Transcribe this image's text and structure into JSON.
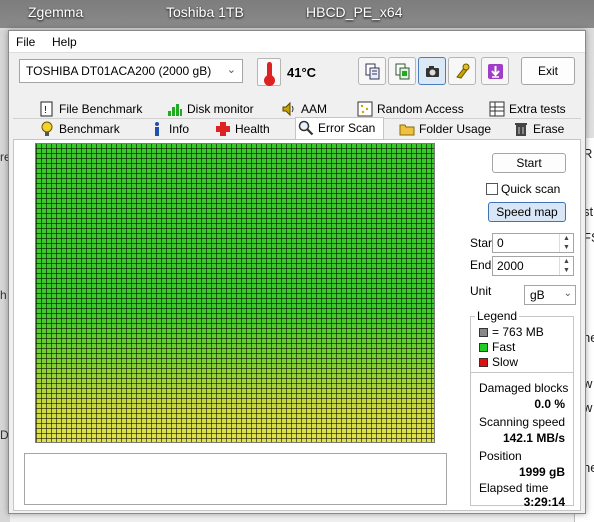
{
  "desktop": {
    "labels": [
      "Zgemma",
      "Toshiba 1TB",
      "HBCD_PE_x64"
    ],
    "right_panel_text": [
      "R",
      "st",
      "FS",
      "ne",
      "w",
      "w",
      "ne"
    ],
    "left_strip_text": [
      "re",
      "h",
      "D"
    ]
  },
  "window": {
    "menu": {
      "file": "File",
      "help": "Help"
    },
    "drive": {
      "selected": "TOSHIBA DT01ACA200 (2000 gB)"
    },
    "temperature": "41°C",
    "toolbar_icons": [
      "copy-text-icon",
      "copy-info-icon",
      "screenshot-camera-icon",
      "options-icon",
      "download-icon"
    ],
    "exit_label": "Exit"
  },
  "tabs": {
    "row1": [
      {
        "label": "File Benchmark",
        "icon": "file-benchmark-icon"
      },
      {
        "label": "Disk monitor",
        "icon": "disk-monitor-icon"
      },
      {
        "label": "AAM",
        "icon": "speaker-icon"
      },
      {
        "label": "Random Access",
        "icon": "random-access-icon"
      },
      {
        "label": "Extra tests",
        "icon": "extra-tests-icon"
      }
    ],
    "row2": [
      {
        "label": "Benchmark",
        "icon": "benchmark-icon"
      },
      {
        "label": "Info",
        "icon": "info-icon"
      },
      {
        "label": "Health",
        "icon": "health-icon"
      },
      {
        "label": "Error Scan",
        "icon": "magnifier-icon"
      },
      {
        "label": "Folder Usage",
        "icon": "folder-icon"
      },
      {
        "label": "Erase",
        "icon": "trash-icon"
      }
    ],
    "selected": "Error Scan"
  },
  "scan": {
    "start_button": "Start",
    "quick_scan_label": "Quick scan",
    "quick_scan_checked": false,
    "speed_map_button": "Speed map",
    "start_label": "Start",
    "start_value": "0",
    "end_label": "End",
    "end_value": "2000",
    "unit_label": "Unit",
    "unit_value": "gB",
    "legend": {
      "title": "Legend",
      "items": [
        {
          "label": "= 763 MB",
          "color": "#888888"
        },
        {
          "label": "Fast",
          "color": "#22cc22"
        },
        {
          "label": "Slow",
          "color": "#dd1111"
        }
      ]
    },
    "stats": {
      "damaged_label": "Damaged blocks",
      "damaged_value": "0.0 %",
      "speed_label": "Scanning speed",
      "speed_value": "142.1 MB/s",
      "position_label": "Position",
      "position_value": "1999 gB",
      "elapsed_label": "Elapsed time",
      "elapsed_value": "3:29:14"
    },
    "map_colors": {
      "fast": "#39c928",
      "slow_end": "#e0e24a",
      "grid": "#000000"
    }
  }
}
